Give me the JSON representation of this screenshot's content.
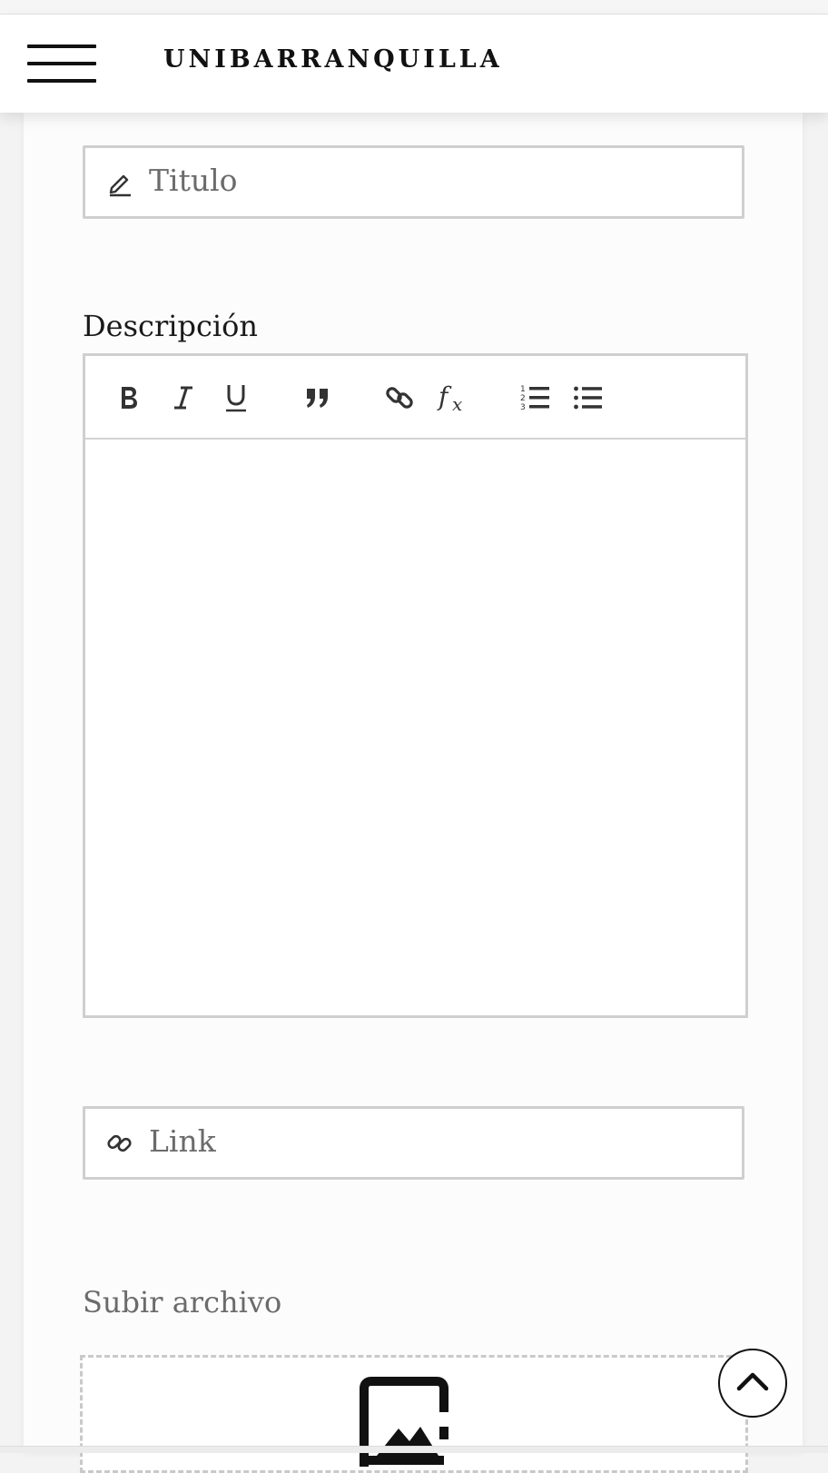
{
  "header": {
    "brand": "UNIBARRANQUILLA",
    "menu_icon": "hamburger-menu-icon"
  },
  "form": {
    "title_field": {
      "placeholder": "Titulo",
      "value": "",
      "icon": "pencil-icon"
    },
    "description": {
      "label": "Descripción",
      "toolbar": [
        {
          "name": "bold",
          "icon": "bold-icon"
        },
        {
          "name": "italic",
          "icon": "italic-icon"
        },
        {
          "name": "underline",
          "icon": "underline-icon"
        },
        {
          "name": "blockquote",
          "icon": "quote-icon"
        },
        {
          "name": "link",
          "icon": "link-icon"
        },
        {
          "name": "formula",
          "icon": "formula-icon"
        },
        {
          "name": "ordered-list",
          "icon": "ordered-list-icon"
        },
        {
          "name": "bullet-list",
          "icon": "bullet-list-icon"
        }
      ],
      "value": ""
    },
    "link_field": {
      "placeholder": "Link",
      "value": "",
      "icon": "link-icon"
    },
    "upload": {
      "label": "Subir archivo",
      "icon": "image-upload-icon"
    }
  },
  "scroll_top": {
    "icon": "chevron-up-icon"
  }
}
